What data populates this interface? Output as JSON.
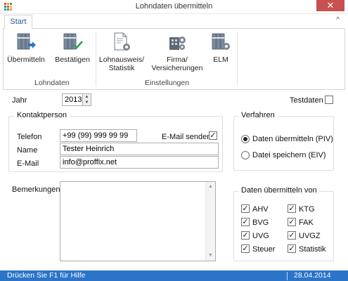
{
  "window": {
    "title": "Lohndaten übermitteln",
    "close_glyph": "✕"
  },
  "ribbon": {
    "tab": "Start",
    "collapse_glyph": "^",
    "buttons": [
      {
        "label": "Übermitteln",
        "icon": "binders-send-icon"
      },
      {
        "label": "Bestätigen",
        "icon": "binders-check-icon"
      },
      {
        "label_line1": "Lohnausweis/",
        "label_line2": "Statistik",
        "icon": "document-gear-icon"
      },
      {
        "label_line1": "Firma/",
        "label_line2": "Versicherungen",
        "icon": "building-gear-icon"
      },
      {
        "label": "ELM",
        "icon": "binders-gear-icon"
      }
    ],
    "groups": {
      "lohndaten": "Lohndaten",
      "einstellungen": "Einstellungen"
    }
  },
  "form": {
    "jahr_label": "Jahr",
    "jahr_value": "2013",
    "testdaten_label": "Testdaten",
    "testdaten_checked": false
  },
  "kontakt": {
    "title": "Kontaktperson",
    "telefon_label": "Telefon",
    "telefon_value": "+99 (99) 999 99 99",
    "email_senden_label": "E-Mail senden",
    "email_senden_checked": true,
    "name_label": "Name",
    "name_value": "Tester Heinrich",
    "email_label": "E-Mail",
    "email_value": "info@proffix.net"
  },
  "verfahren": {
    "title": "Verfahren",
    "options": [
      "Daten übermitteln (PIV)",
      "Datei speichern (EIV)"
    ],
    "selected_index": 0
  },
  "bemerkungen": {
    "label": "Bemerkungen",
    "value": ""
  },
  "daten_von": {
    "title": "Daten übermitteln von",
    "items": [
      {
        "label": "AHV",
        "checked": true
      },
      {
        "label": "KTG",
        "checked": true
      },
      {
        "label": "BVG",
        "checked": true
      },
      {
        "label": "FAK",
        "checked": true
      },
      {
        "label": "UVG",
        "checked": true
      },
      {
        "label": "UVGZ",
        "checked": true
      },
      {
        "label": "Steuer",
        "checked": true
      },
      {
        "label": "Statistik",
        "checked": true
      }
    ]
  },
  "statusbar": {
    "help": "Drücken Sie F1 für Hilfe",
    "date": "28.04.2014"
  },
  "colors": {
    "accent": "#2b74c7",
    "close": "#c75050",
    "tab_text": "#2b579a"
  }
}
